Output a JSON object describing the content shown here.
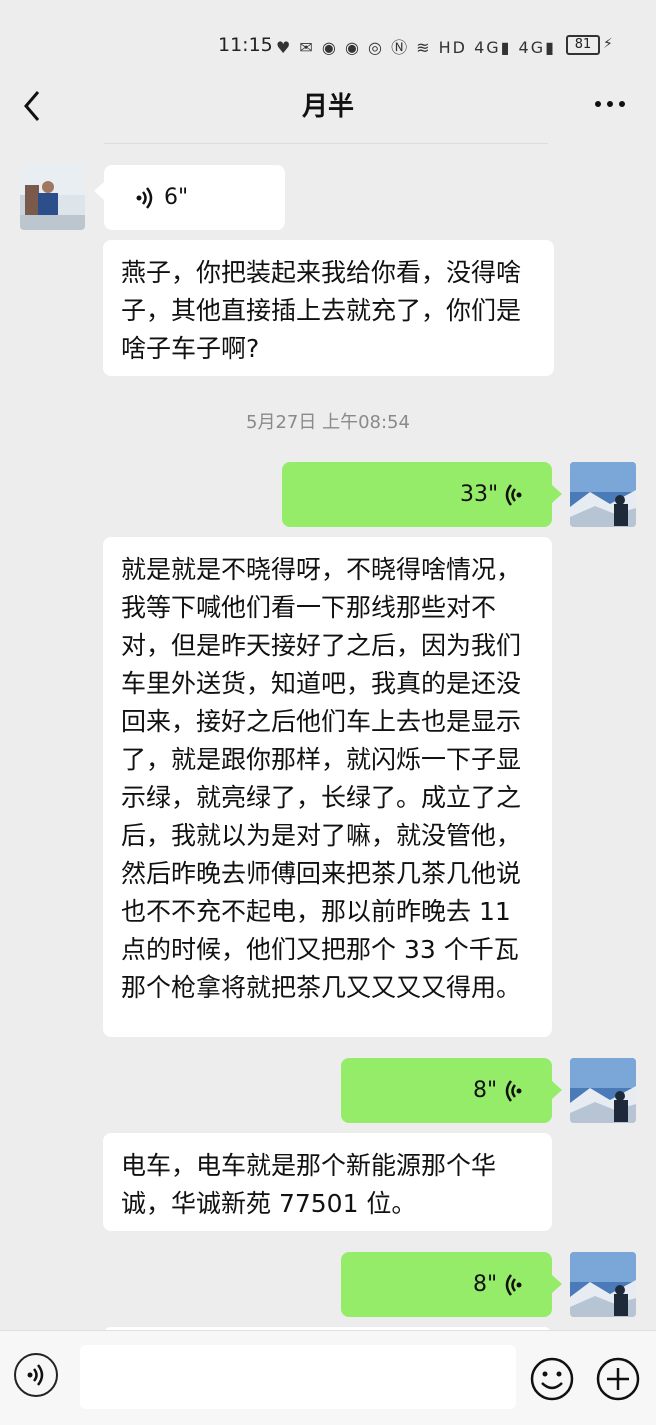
{
  "status_bar": {
    "time": "11:15",
    "icons": "♥ ✉ ◉ ◉  ◎ Ⓝ ≋ HD 4G▮ 4G▮",
    "battery": "81"
  },
  "header": {
    "title": "月半"
  },
  "messages": [
    {
      "type": "voice",
      "side": "left",
      "duration": "6\""
    },
    {
      "type": "text",
      "side": "left",
      "text": "燕子，你把装起来我给你看，没得啥子，其他直接插上去就充了，你们是啥子车子啊?"
    },
    {
      "type": "timestamp",
      "text": "5月27日 上午08:54"
    },
    {
      "type": "voice",
      "side": "right",
      "duration": "33\""
    },
    {
      "type": "text",
      "side": "left",
      "text": "就是就是不晓得呀，不晓得啥情况，我等下喊他们看一下那线那些对不对，但是昨天接好了之后，因为我们车里外送货，知道吧，我真的是还没回来，接好之后他们车上去也是显示了，就是跟你那样，就闪烁一下子显示绿，就亮绿了，长绿了。成立了之后，我就以为是对了嘛，就没管他，然后昨晚去师傅回来把茶几茶几他说也不不充不起电，那以前昨晚去 11 点的时候，他们又把那个 33 个千瓦那个枪拿将就把茶几又又又又得用。"
    },
    {
      "type": "voice",
      "side": "right",
      "duration": "8\""
    },
    {
      "type": "text",
      "side": "left",
      "text": "电车，电车就是那个新能源那个华诚，华诚新苑 77501 位。"
    },
    {
      "type": "voice",
      "side": "right",
      "duration": "8\""
    }
  ],
  "colors": {
    "background": "#ededed",
    "bubble_self": "#95ec69",
    "bubble_other": "#ffffff",
    "timestamp": "#8a8a8a"
  },
  "icons": {
    "back": "chevron-left-icon",
    "more": "more-dots-icon",
    "voice_mode": "voice-mode-icon",
    "emoji": "emoji-icon",
    "plus": "plus-icon"
  }
}
